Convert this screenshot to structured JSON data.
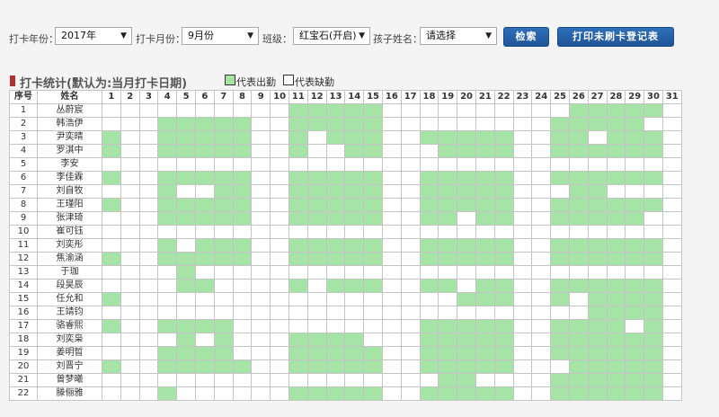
{
  "filters": {
    "year_label": "打卡年份：",
    "year_value": "2017年",
    "month_label": "打卡月份：",
    "month_value": "9月份",
    "class_label": "班级：",
    "class_value": "红宝石(开启)",
    "child_label": "孩子姓名：",
    "child_value": "请选择",
    "search_label": "检索",
    "print_label": "打印未刷卡登记表"
  },
  "section": {
    "title": "打卡统计(默认为:当月打卡日期)",
    "legend_present": "代表出勤",
    "legend_absent": "代表缺勤"
  },
  "colors": {
    "present": "#a6e3a6",
    "absent": "#ffffff",
    "button": "#2a62a8"
  },
  "table": {
    "col_seq": "序号",
    "col_name": "姓名",
    "days": [
      "1",
      "2",
      "3",
      "4",
      "5",
      "6",
      "7",
      "8",
      "9",
      "10",
      "11",
      "12",
      "13",
      "14",
      "15",
      "16",
      "17",
      "18",
      "19",
      "20",
      "21",
      "22",
      "23",
      "24",
      "25",
      "26",
      "27",
      "28",
      "29",
      "30",
      "31"
    ],
    "rows": [
      {
        "seq": "1",
        "name": "丛蔚宸",
        "present": [
          11,
          12,
          13,
          14,
          15,
          26,
          27,
          28,
          29,
          30
        ]
      },
      {
        "seq": "2",
        "name": "韩浩伊",
        "present": [
          4,
          5,
          6,
          7,
          8,
          11,
          12,
          13,
          14,
          15,
          25,
          26,
          27,
          28,
          29
        ]
      },
      {
        "seq": "3",
        "name": "尹奕晴",
        "present": [
          1,
          4,
          5,
          6,
          7,
          8,
          11,
          13,
          14,
          15,
          18,
          19,
          20,
          21,
          22,
          25,
          26,
          28,
          29,
          30
        ]
      },
      {
        "seq": "4",
        "name": "罗淇中",
        "present": [
          1,
          4,
          5,
          6,
          7,
          8,
          11,
          14,
          15,
          19,
          20,
          21,
          22,
          25,
          26,
          27,
          28,
          29,
          30
        ]
      },
      {
        "seq": "5",
        "name": "李安",
        "present": []
      },
      {
        "seq": "6",
        "name": "李佳霖",
        "present": [
          1,
          4,
          5,
          6,
          7,
          8,
          11,
          12,
          13,
          14,
          15,
          18,
          19,
          20,
          21,
          22,
          25,
          26,
          27,
          28,
          29,
          30
        ]
      },
      {
        "seq": "7",
        "name": "刘自牧",
        "present": [
          4,
          7,
          8,
          11,
          12,
          13,
          14,
          15,
          18,
          19,
          20,
          21,
          22,
          26,
          27
        ]
      },
      {
        "seq": "8",
        "name": "王瑾阳",
        "present": [
          1,
          4,
          5,
          6,
          7,
          8,
          11,
          12,
          13,
          14,
          15,
          18,
          19,
          20,
          21,
          22,
          25,
          26,
          27,
          28,
          29,
          30
        ]
      },
      {
        "seq": "9",
        "name": "张津琦",
        "present": [
          4,
          5,
          6,
          7,
          8,
          11,
          12,
          13,
          14,
          15,
          18,
          19,
          21,
          22,
          25,
          26,
          27,
          28,
          29
        ]
      },
      {
        "seq": "10",
        "name": "崔可钰",
        "present": []
      },
      {
        "seq": "11",
        "name": "刘奕彤",
        "present": [
          4,
          6,
          7,
          8,
          11,
          12,
          13,
          14,
          15,
          18,
          19,
          20,
          21,
          22,
          25,
          26,
          27,
          28,
          29,
          30
        ]
      },
      {
        "seq": "12",
        "name": "焦渝涵",
        "present": [
          1,
          4,
          5,
          6,
          7,
          8,
          11,
          12,
          13,
          14,
          15,
          18,
          19,
          20,
          21,
          22,
          25,
          26,
          27,
          28,
          29,
          30
        ]
      },
      {
        "seq": "13",
        "name": "于珈",
        "present": [
          5
        ]
      },
      {
        "seq": "14",
        "name": "段昊辰",
        "present": [
          5,
          6,
          11,
          13,
          14,
          15,
          18,
          19,
          21,
          22,
          25,
          26,
          27,
          28,
          29,
          30
        ]
      },
      {
        "seq": "15",
        "name": "任允和",
        "present": [
          1,
          20,
          21,
          22,
          25,
          27,
          28,
          29,
          30
        ]
      },
      {
        "seq": "16",
        "name": "王靖钧",
        "present": [
          27,
          28,
          29,
          30
        ]
      },
      {
        "seq": "17",
        "name": "骆睿熙",
        "present": [
          1,
          4,
          5,
          6,
          7,
          18,
          19,
          20,
          21,
          22,
          25,
          26,
          27,
          28,
          30
        ]
      },
      {
        "seq": "18",
        "name": "刘奕枭",
        "present": [
          5,
          7,
          11,
          12,
          13,
          14,
          18,
          19,
          20,
          21,
          22,
          25,
          26,
          27,
          28,
          29,
          30
        ]
      },
      {
        "seq": "19",
        "name": "姜明晢",
        "present": [
          4,
          5,
          6,
          7,
          11,
          12,
          13,
          14,
          15,
          18,
          19,
          20,
          21,
          22,
          25,
          26,
          27,
          28,
          29,
          30
        ]
      },
      {
        "seq": "20",
        "name": "刘晋宁",
        "present": [
          1,
          4,
          5,
          6,
          7,
          8,
          11,
          12,
          13,
          14,
          15,
          18,
          19,
          20,
          21,
          22,
          26,
          27,
          28,
          29,
          30
        ]
      },
      {
        "seq": "21",
        "name": "曾梦曦",
        "present": [
          19,
          20,
          25,
          26,
          27,
          28,
          29,
          30
        ]
      },
      {
        "seq": "22",
        "name": "滕俪雅",
        "present": [
          4,
          11,
          12,
          13,
          14,
          15,
          18,
          19,
          20,
          21,
          22,
          25,
          26,
          27,
          28,
          29,
          30
        ]
      }
    ]
  }
}
